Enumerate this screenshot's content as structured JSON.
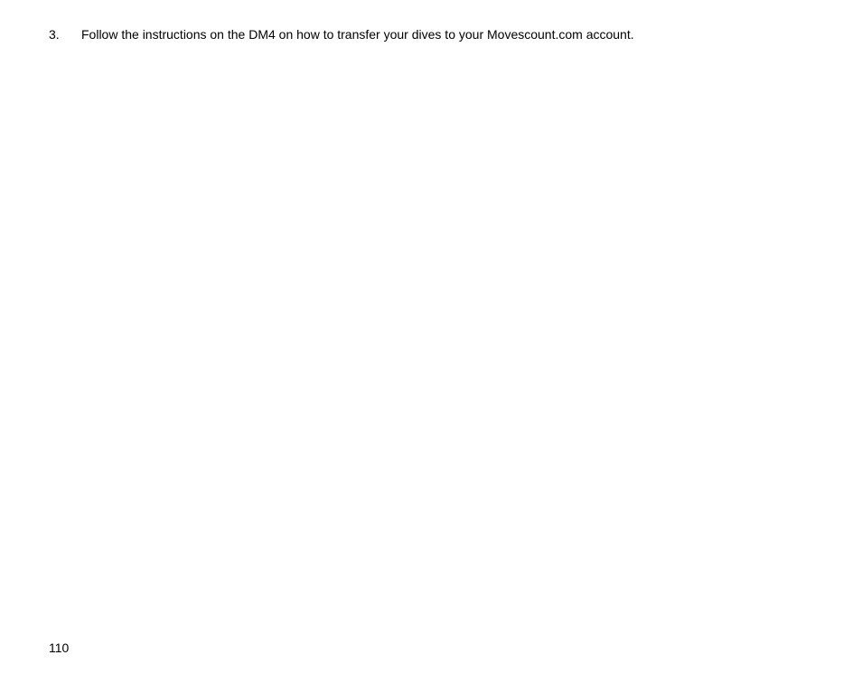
{
  "page": {
    "number": "110",
    "list_item": {
      "number": "3.",
      "text": "Follow the instructions on the DM4 on how to transfer your dives to your Movescount.com account."
    }
  }
}
